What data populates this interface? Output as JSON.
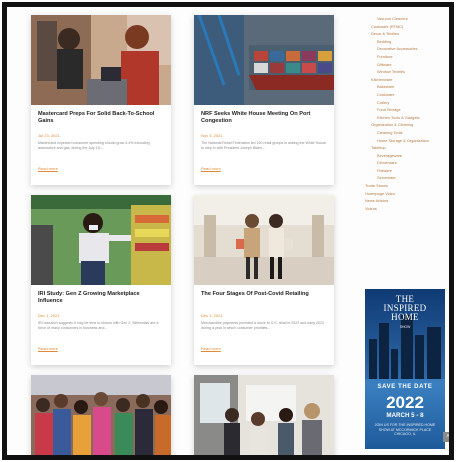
{
  "articles": [
    {
      "title": "Mastercard Preps For Solid Back-To-School Gains",
      "date": "Jul 23, 2021",
      "excerpt": "Mastercard expected consumer spending should grow 4.4% excluding automotive and gas, during the July 15-...",
      "more": "Read more"
    },
    {
      "title": "NRF Seeks White House Meeting On Port Congestion",
      "date": "Nov 3, 2021",
      "excerpt": "The National Retail Federation led 150 retail groups in asking the White House to step in with President Joseph Biden...",
      "more": "Read more"
    },
    {
      "title": "IRI Study: Gen Z Growing Marketplace Influence",
      "date": "Dec 1, 2021",
      "excerpt": "IRI research suggests it may be time to reckon with Gen Z. Millennials are a force of many consumers in business and...",
      "more": "Read more"
    },
    {
      "title": "The Four Stages Of Post-Covid Retailing",
      "date": "Dec 1, 2021",
      "excerpt": "Merchandise payments provided a move to U.S. retail in 2022 and early 2023 during a year in which consumer priorities...",
      "more": "Read more"
    },
    {
      "title": "",
      "date": "",
      "excerpt": "",
      "more": ""
    },
    {
      "title": "",
      "date": "",
      "excerpt": "",
      "more": ""
    }
  ],
  "sidebar": {
    "links": [
      {
        "label": "Vacuum Cleaners",
        "level": 3
      },
      {
        "label": "Cookware (RTMC)",
        "level": 2
      },
      {
        "label": "Decor & Textiles",
        "level": 2
      },
      {
        "label": "Bedding",
        "level": 3
      },
      {
        "label": "Decorative Accessories",
        "level": 3
      },
      {
        "label": "Furniture",
        "level": 3
      },
      {
        "label": "Giftware",
        "level": 3
      },
      {
        "label": "Window Textiles",
        "level": 3
      },
      {
        "label": "Kitchenware",
        "level": 2
      },
      {
        "label": "Bakeware",
        "level": 3
      },
      {
        "label": "Cookware",
        "level": 3
      },
      {
        "label": "Cutlery",
        "level": 3
      },
      {
        "label": "Food Storage",
        "level": 3
      },
      {
        "label": "Kitchen Tools & Gadgets",
        "level": 3
      },
      {
        "label": "Organization & Cleaning",
        "level": 2
      },
      {
        "label": "Cleaning Tools",
        "level": 3
      },
      {
        "label": "Home Storage & Organization",
        "level": 3
      },
      {
        "label": "Tabletop",
        "level": 2
      },
      {
        "label": "Beverageware",
        "level": 3
      },
      {
        "label": "Dinnerware",
        "level": 3
      },
      {
        "label": "Flatware",
        "level": 3
      },
      {
        "label": "Serveware",
        "level": 3
      },
      {
        "label": "Trade Shows",
        "level": 1
      },
      {
        "label": "Homepage Video",
        "level": 1
      },
      {
        "label": "News Articles",
        "level": 1
      },
      {
        "label": "Videos",
        "level": 1
      }
    ]
  },
  "ad": {
    "logo_line1": "THE",
    "logo_line2": "INSPIRED",
    "logo_line3": "HOME",
    "logo_sub": "SHOW",
    "save": "SAVE THE DATE",
    "year": "2022",
    "dates": "MARCH 5 - 8",
    "join": "JOIN US FOR THE INSPIRED HOME SHOW AT MCCORMICK PLACE CHICAGO, IL",
    "colors": {
      "background": "#2a6fb2",
      "text": "#ffffff"
    }
  },
  "scroll_top": {
    "icon": "chevron-up-icon",
    "glyph": "˄"
  },
  "accent_color": "#e08a3a"
}
